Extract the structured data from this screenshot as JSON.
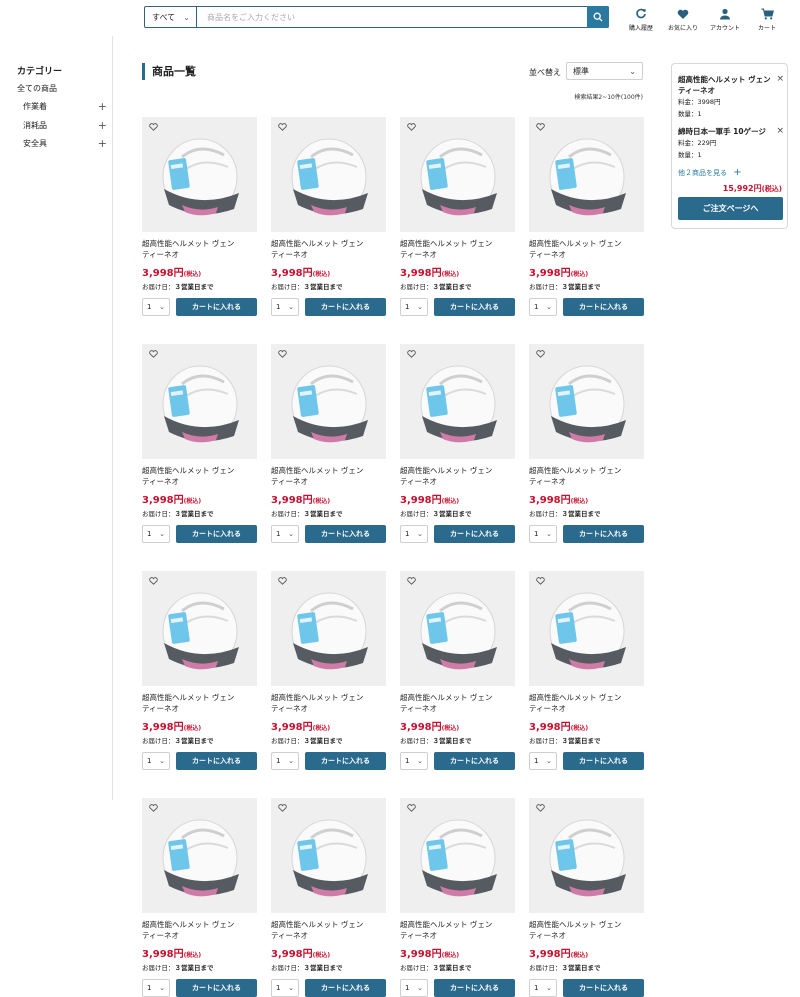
{
  "header": {
    "search_scope": "すべて",
    "search_placeholder": "商品名をご入力ください",
    "icons": [
      {
        "name": "history-icon",
        "label": "購入履歴"
      },
      {
        "name": "heart-icon",
        "label": "お気に入り"
      },
      {
        "name": "account-icon",
        "label": "アカウント"
      },
      {
        "name": "cart-icon",
        "label": "カート"
      }
    ]
  },
  "sidebar": {
    "title": "カテゴリー",
    "all": "全ての商品",
    "items": [
      "作業着",
      "消耗品",
      "安全具"
    ]
  },
  "main": {
    "title": "商品一覧",
    "sort_label": "並べ替え",
    "sort_value": "標準",
    "result_count": "検索結果2~10件(100件)"
  },
  "product": {
    "name_line1": "超高性能ヘルメット ヴェン",
    "name_line2": "ティーネオ",
    "price": "3,998円",
    "tax": "(税込)",
    "delivery_label": "お届け日：",
    "delivery_value": "３営業日まで",
    "qty": "1",
    "cart_button": "カートに入れる"
  },
  "minicart": {
    "items": [
      {
        "name": "超高性能ヘルメット ヴェンティーネオ",
        "price": "料金：3998円",
        "qty": "数量：1"
      },
      {
        "name": "綿時日本一軍手 10ゲージ",
        "price": "料金：229円",
        "qty": "数量：1"
      }
    ],
    "more": "他２商品を見る",
    "total": "15,992円",
    "total_tax": "(税込)",
    "order_button": "ご注文ページへ"
  },
  "colors": {
    "accent": "#2a6a8d",
    "price": "#c8102e"
  }
}
